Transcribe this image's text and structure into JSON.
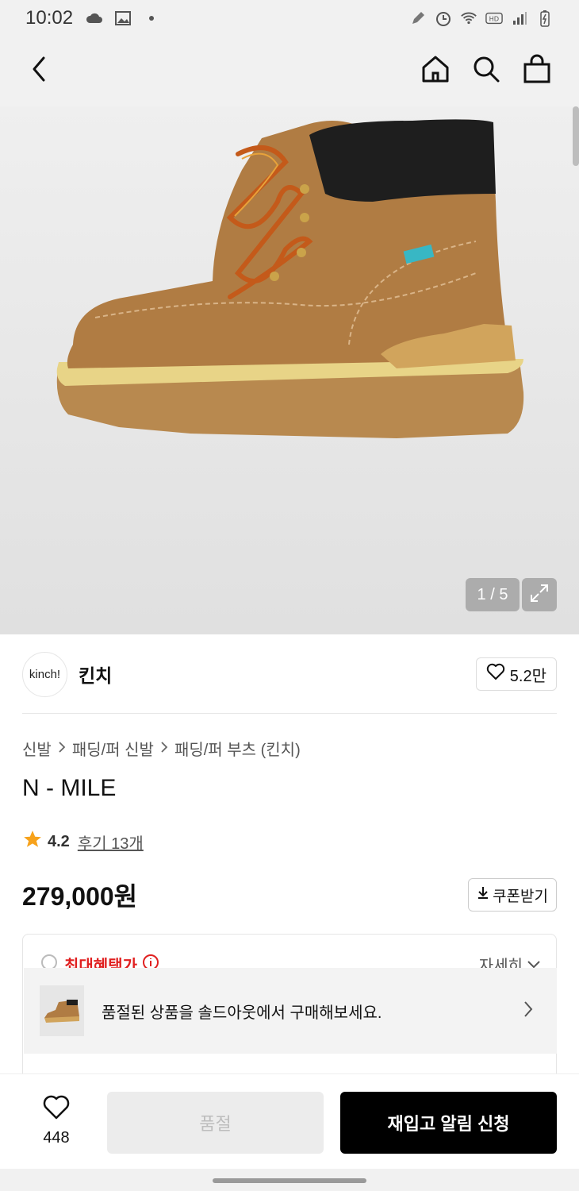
{
  "status_bar": {
    "time": "10:02",
    "left_icons": [
      "cloud-icon",
      "gallery-icon",
      "dot-icon"
    ],
    "right_icons": [
      "pencil-icon",
      "alarm-icon",
      "wifi-icon",
      "hd-icon",
      "signal-icon",
      "battery-icon"
    ]
  },
  "header": {
    "icons": [
      "back-icon",
      "home-icon",
      "search-icon",
      "bag-icon"
    ]
  },
  "gallery": {
    "page_indicator": "1 / 5"
  },
  "brand": {
    "logo_text": "kinch!",
    "name": "킨치",
    "likes": "5.2만"
  },
  "breadcrumb": [
    "신발",
    "패딩/퍼 신발",
    "패딩/퍼 부츠 (킨치)"
  ],
  "product": {
    "title": "N - MILE",
    "rating": "4.2",
    "reviews": "후기 13개",
    "price": "279,000원"
  },
  "coupon": {
    "label": "쿠폰받기"
  },
  "benefit": {
    "title": "최대혜택가",
    "detail": "자세히"
  },
  "soldout_banner": {
    "text": "품절된 상품을 솔드아웃에서 구매해보세요."
  },
  "bottom": {
    "wish_count": "448",
    "soldout_label": "품절",
    "restock_label": "재입고 알림 신청"
  },
  "colors": {
    "accent_red": "#e02020",
    "primary_black": "#000000",
    "disabled_gray": "#ececec"
  }
}
